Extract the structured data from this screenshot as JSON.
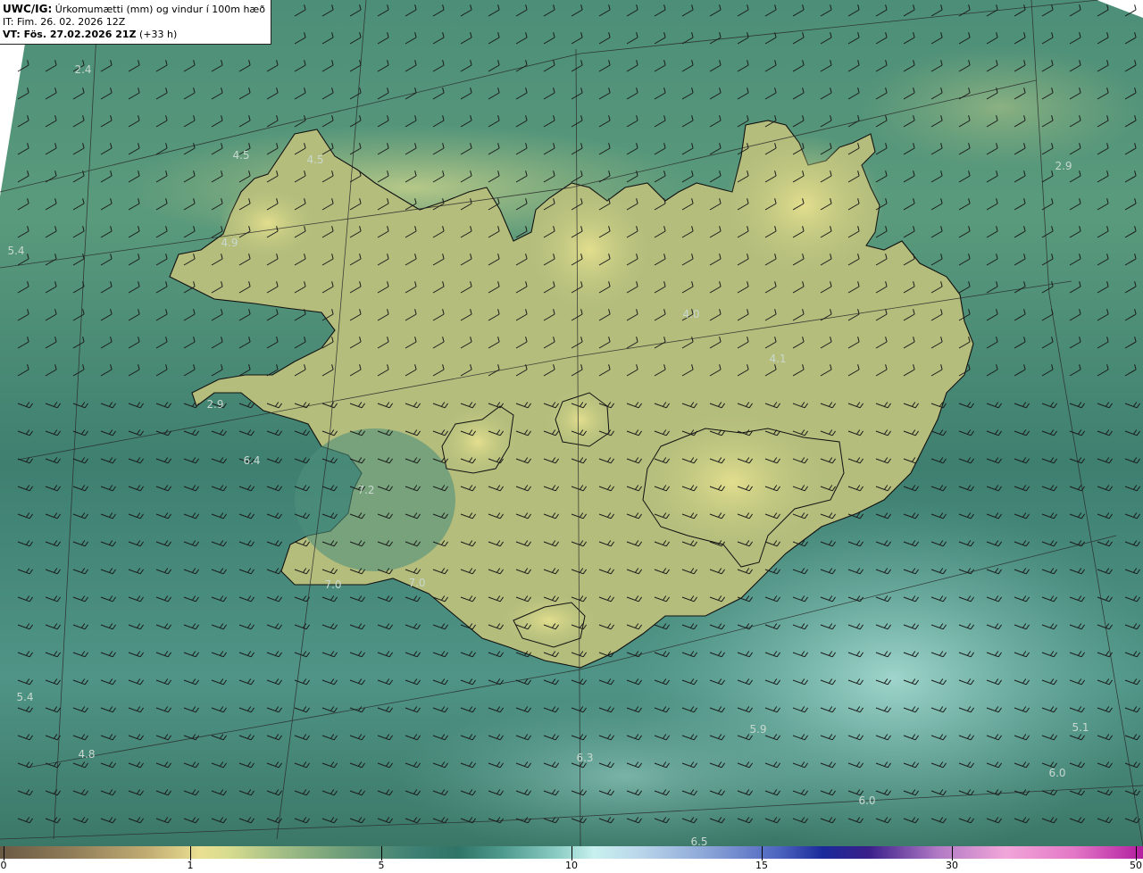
{
  "header": {
    "model_code": "UWC/IG:",
    "title_rest": " Úrkomumætti (mm) og vindur í 100m hæð",
    "init_time": "IT: Fim. 26. 02. 2026 12Z",
    "valid_bold": "VT: Fös. 27.02.2026 21Z",
    "valid_offset": " (+33 h)"
  },
  "colorbar": {
    "ticks": [
      "0",
      "1",
      "5",
      "10",
      "15",
      "30",
      "50"
    ]
  },
  "value_labels": [
    "2.4",
    "4.5",
    "4.5",
    "5.4",
    "4.9",
    "2.9",
    "6.4",
    "7.2",
    "7.0",
    "7.0",
    "4.0",
    "4.1",
    "2.9",
    "5.4",
    "4.8",
    "6.3",
    "5.9",
    "6.0",
    "5.1",
    "6.0",
    "6.5"
  ],
  "colors": {
    "sea_teal": "#3c7b6e",
    "land_yellow": "#d8d88a",
    "coast_line": "#111111",
    "barb_line": "#1a1a1a"
  }
}
